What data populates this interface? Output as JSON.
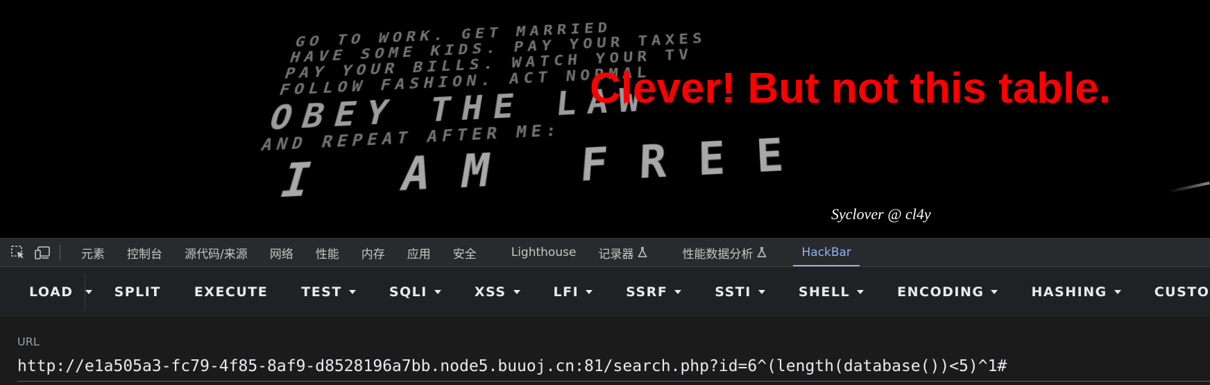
{
  "page": {
    "background_text_lines": [
      "GO TO WORK. GET MARRIED",
      "HAVE SOME KIDS. PAY YOUR TAXES",
      "PAY YOUR BILLS. WATCH YOUR TV",
      "FOLLOW FASHION. ACT NORMAL",
      "OBEY THE LAW",
      "AND REPEAT AFTER ME:",
      "I AM FREE"
    ],
    "headline": "Clever! But not this table.",
    "headline_color": "#ff0000",
    "credit": "Syclover @ cl4y"
  },
  "devtools": {
    "tabs": [
      {
        "label": "元素"
      },
      {
        "label": "控制台"
      },
      {
        "label": "源代码/来源"
      },
      {
        "label": "网络"
      },
      {
        "label": "性能"
      },
      {
        "label": "内存"
      },
      {
        "label": "应用"
      },
      {
        "label": "安全"
      },
      {
        "label": "Lighthouse"
      },
      {
        "label": "记录器"
      },
      {
        "label": "性能数据分析"
      },
      {
        "label": "HackBar"
      }
    ],
    "active_tab": "HackBar",
    "accent_color": "#8ab4f8"
  },
  "hackbar": {
    "buttons": {
      "load": "LOAD",
      "split": "SPLIT",
      "execute": "EXECUTE",
      "test": "TEST",
      "sqli": "SQLI",
      "xss": "XSS",
      "lfi": "LFI",
      "ssrf": "SSRF",
      "ssti": "SSTI",
      "shell": "SHELL",
      "encoding": "ENCODING",
      "hashing": "HASHING",
      "custom": "CUSTOM"
    },
    "url_label": "URL",
    "url_value": "http://e1a505a3-fc79-4f85-8af9-d8528196a7bb.node5.buuoj.cn:81/search.php?id=6^(length(database())<5)^1#"
  }
}
